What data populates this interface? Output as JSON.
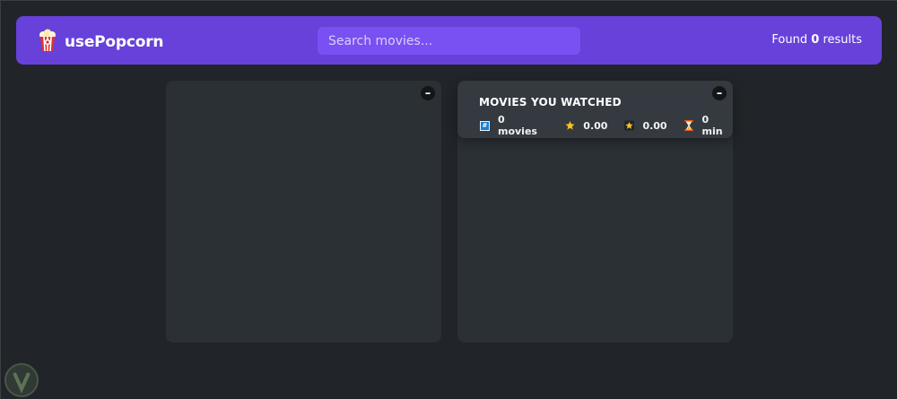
{
  "nav": {
    "logo_icon": "popcorn-icon",
    "logo_text": "usePopcorn",
    "search_placeholder": "Search movies...",
    "search_value": "",
    "results_prefix": "Found ",
    "results_count": "0",
    "results_suffix": " results"
  },
  "list_box": {
    "toggle_label": "–"
  },
  "watched_box": {
    "toggle_label": "–",
    "title": "Movies you watched",
    "stats": {
      "movies": "0 movies",
      "imdb_rating": "0.00",
      "user_rating": "0.00",
      "runtime": "0 min"
    },
    "icons": [
      "hash-icon",
      "star-icon",
      "star-badge-icon",
      "hourglass-icon"
    ]
  },
  "colors": {
    "background": "#212529",
    "nav": "#6741d9",
    "search": "#7950f2",
    "box": "#2b3035",
    "summary": "#343a40"
  }
}
